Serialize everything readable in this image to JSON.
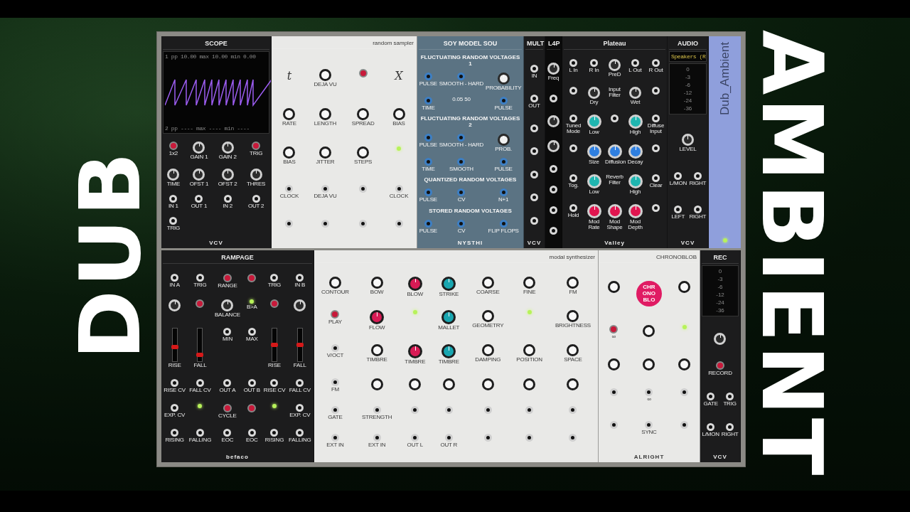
{
  "overlay": {
    "left_title": "DUB",
    "right_title": "AMBIENT"
  },
  "rows": [
    {
      "modules": [
        {
          "kind": "panel",
          "color": "#1c1c1d",
          "title": "SCOPE",
          "footer": "VCV",
          "screen": {
            "top": "1 pp 10.00 max 10.00 min 0.00",
            "bottom": "2 pp ---- max ---- min ----"
          },
          "controls": [
            {
              "kind": "button",
              "label": "1x2"
            },
            {
              "kind": "knob",
              "label": "GAIN 1"
            },
            {
              "kind": "knob",
              "label": "GAIN 2"
            },
            {
              "kind": "button",
              "label": "TRIG"
            },
            {
              "kind": "knob",
              "label": "TIME"
            },
            {
              "kind": "knob",
              "label": "OFST 1"
            },
            {
              "kind": "knob",
              "label": "OFST 2"
            },
            {
              "kind": "knob",
              "label": "THRES"
            },
            {
              "kind": "jack",
              "label": "IN 1"
            },
            {
              "kind": "jack",
              "label": "OUT 1"
            },
            {
              "kind": "jack",
              "label": "IN 2"
            },
            {
              "kind": "jack",
              "label": "OUT 2"
            },
            {
              "kind": "jack",
              "label": "TRIG"
            }
          ]
        },
        {
          "kind": "panel",
          "color": "#e9e9e7",
          "title": "random sampler",
          "controls": [
            {
              "kind": "glyph",
              "label": "t"
            },
            {
              "kind": "knob",
              "label": "DEJA VU"
            },
            {
              "kind": "button"
            },
            {
              "kind": "glyph",
              "label": "X"
            },
            {
              "kind": "knob",
              "label": "RATE"
            },
            {
              "kind": "knob",
              "label": "LENGTH"
            },
            {
              "kind": "knob",
              "label": "SPREAD"
            },
            {
              "kind": "knob",
              "label": "BIAS"
            },
            {
              "kind": "knob",
              "label": "BIAS"
            },
            {
              "kind": "knob",
              "label": "JITTER"
            },
            {
              "kind": "knob",
              "label": "STEPS"
            },
            {
              "kind": "led"
            },
            {
              "kind": "jack",
              "label": "CLOCK"
            },
            {
              "kind": "jack",
              "label": "DEJA VU"
            },
            {
              "kind": "jack"
            },
            {
              "kind": "jack",
              "label": "CLOCK"
            },
            {
              "kind": "jack"
            },
            {
              "kind": "jack"
            },
            {
              "kind": "jack"
            },
            {
              "kind": "jack"
            }
          ]
        },
        {
          "kind": "panel",
          "color": "#5b7383",
          "title": "SOY MODEL SOU",
          "footer": "NYSTHI",
          "controls": [
            {
              "kind": "heading",
              "label": "FLUCTUATING RANDOM VOLTAGES 1"
            },
            {
              "kind": "jack",
              "label": "PULSE"
            },
            {
              "kind": "jack",
              "label": "SMOOTH - HARD"
            },
            {
              "kind": "knob",
              "label": "PROBABILITY"
            },
            {
              "kind": "jack",
              "label": "TIME"
            },
            {
              "kind": "text",
              "label": "0.05 50"
            },
            {
              "kind": "jack",
              "label": "PULSE"
            },
            {
              "kind": "heading",
              "label": "FLUCTUATING RANDOM VOLTAGES 2"
            },
            {
              "kind": "jack",
              "label": "PULSE"
            },
            {
              "kind": "jack",
              "label": "SMOOTH - HARD"
            },
            {
              "kind": "knob",
              "label": "PROB."
            },
            {
              "kind": "jack",
              "label": "TIME"
            },
            {
              "kind": "jack",
              "label": "SMOOTH"
            },
            {
              "kind": "jack",
              "label": "PULSE"
            },
            {
              "kind": "heading",
              "label": "QUANTIZED RANDOM VOLTAGES"
            },
            {
              "kind": "jack",
              "label": "PULSE"
            },
            {
              "kind": "jack",
              "label": "CV"
            },
            {
              "kind": "jack",
              "label": "N+1"
            },
            {
              "kind": "heading",
              "label": "STORED RANDOM VOLTAGES"
            },
            {
              "kind": "jack",
              "label": "PULSE"
            },
            {
              "kind": "jack",
              "label": "CV"
            },
            {
              "kind": "jack",
              "label": "FLIP FLOPS"
            }
          ]
        },
        {
          "kind": "panel",
          "color": "#1c1c1d",
          "title": "MULT",
          "footer": "VCV",
          "controls": [
            {
              "kind": "jack",
              "label": "IN"
            },
            {
              "kind": "jack",
              "label": "OUT"
            },
            {
              "kind": "jack"
            },
            {
              "kind": "jack"
            },
            {
              "kind": "jack"
            },
            {
              "kind": "jack"
            },
            {
              "kind": "jack"
            }
          ]
        },
        {
          "kind": "panel",
          "color": "#0b0b0b",
          "title": "L4P",
          "controls": [
            {
              "kind": "knob",
              "label": "Freq"
            },
            {
              "kind": "jack"
            },
            {
              "kind": "knob"
            },
            {
              "kind": "knob"
            },
            {
              "kind": "jack"
            },
            {
              "kind": "jack"
            },
            {
              "kind": "jack"
            },
            {
              "kind": "jack"
            }
          ]
        },
        {
          "kind": "panel",
          "color": "#1c1c1d",
          "title": "Plateau",
          "footer": "Valley",
          "controls": [
            {
              "kind": "jack",
              "label": "L In"
            },
            {
              "kind": "jack",
              "label": "R In"
            },
            {
              "kind": "knob",
              "label": "PreD"
            },
            {
              "kind": "jack",
              "label": "L Out"
            },
            {
              "kind": "jack",
              "label": "R Out"
            },
            {
              "kind": "jack"
            },
            {
              "kind": "knob",
              "label": "Dry"
            },
            {
              "kind": "text",
              "label": "Input Filter"
            },
            {
              "kind": "knob",
              "label": "Wet"
            },
            {
              "kind": "jack"
            },
            {
              "kind": "jack",
              "label": "Tuned Mode"
            },
            {
              "kind": "knob",
              "label": "Low",
              "color": "#1fb5b0"
            },
            {
              "kind": "jack"
            },
            {
              "kind": "knob",
              "label": "High",
              "color": "#1fb5b0"
            },
            {
              "kind": "jack",
              "label": "Diffuse Input"
            },
            {
              "kind": "jack"
            },
            {
              "kind": "knob",
              "label": "Size",
              "color": "#2f7fe0"
            },
            {
              "kind": "knob",
              "label": "Diffusion",
              "color": "#2f7fe0"
            },
            {
              "kind": "knob",
              "label": "Decay",
              "color": "#2f7fe0"
            },
            {
              "kind": "jack"
            },
            {
              "kind": "jack",
              "label": "Tog."
            },
            {
              "kind": "knob",
              "label": "Low",
              "color": "#1fb5b0"
            },
            {
              "kind": "text",
              "label": "Reverb Filter"
            },
            {
              "kind": "knob",
              "label": "High",
              "color": "#1fb5b0"
            },
            {
              "kind": "jack",
              "label": "Clear"
            },
            {
              "kind": "jack",
              "label": "Hold"
            },
            {
              "kind": "knob",
              "label": "Mod Rate",
              "color": "#e0154f"
            },
            {
              "kind": "knob",
              "label": "Mod Shape",
              "color": "#e0154f"
            },
            {
              "kind": "knob",
              "label": "Mod Depth",
              "color": "#e0154f"
            },
            {
              "kind": "jack"
            }
          ]
        },
        {
          "kind": "panel",
          "color": "#1c1c1d",
          "title": "AUDIO",
          "footer": "VCV",
          "display": "Speakers (R",
          "meter": [
            "0",
            "-3",
            "-6",
            "-12",
            "-24",
            "-36"
          ],
          "controls": [
            {
              "kind": "knob",
              "label": "LEVEL",
              "wide": true
            },
            {
              "kind": "jack",
              "label": "L/MON"
            },
            {
              "kind": "jack",
              "label": "RIGHT"
            },
            {
              "kind": "jack",
              "label": "LEFT"
            },
            {
              "kind": "jack",
              "label": "RIGHT"
            }
          ]
        },
        {
          "kind": "notes",
          "text": "Dub_Ambient"
        }
      ]
    },
    {
      "modules": [
        {
          "kind": "panel",
          "color": "#1c1c1d",
          "title": "RAMPAGE",
          "footer": "befaco",
          "controls": [
            {
              "kind": "jack",
              "label": "IN A"
            },
            {
              "kind": "jack",
              "label": "TRIG"
            },
            {
              "kind": "button",
              "label": "RANGE"
            },
            {
              "kind": "button"
            },
            {
              "kind": "jack",
              "label": "TRIG"
            },
            {
              "kind": "jack",
              "label": "IN B"
            },
            {
              "kind": "knob"
            },
            {
              "kind": "button"
            },
            {
              "kind": "knob",
              "label": "BALANCE"
            },
            {
              "kind": "led",
              "label": "B>A"
            },
            {
              "kind": "button"
            },
            {
              "kind": "knob"
            },
            {
              "kind": "slider",
              "label": "RISE",
              "level": 0.45
            },
            {
              "kind": "slider",
              "label": "FALL",
              "level": 0.2
            },
            {
              "kind": "jack",
              "label": "MIN"
            },
            {
              "kind": "jack",
              "label": "MAX"
            },
            {
              "kind": "slider",
              "label": "RISE",
              "level": 0.5
            },
            {
              "kind": "slider",
              "label": "FALL",
              "level": 0.5
            },
            {
              "kind": "jack",
              "label": "RISE CV"
            },
            {
              "kind": "jack",
              "label": "FALL CV"
            },
            {
              "kind": "jack",
              "label": "OUT A"
            },
            {
              "kind": "jack",
              "label": "OUT B"
            },
            {
              "kind": "jack",
              "label": "RISE CV"
            },
            {
              "kind": "jack",
              "label": "FALL CV"
            },
            {
              "kind": "jack",
              "label": "EXP. CV"
            },
            {
              "kind": "led"
            },
            {
              "kind": "button",
              "label": "CYCLE"
            },
            {
              "kind": "button"
            },
            {
              "kind": "led"
            },
            {
              "kind": "jack",
              "label": "EXP. CV"
            },
            {
              "kind": "jack",
              "label": "RISING"
            },
            {
              "kind": "jack",
              "label": "FALLING"
            },
            {
              "kind": "jack",
              "label": "EOC"
            },
            {
              "kind": "jack",
              "label": "EOC"
            },
            {
              "kind": "jack",
              "label": "RISING"
            },
            {
              "kind": "jack",
              "label": "FALLING"
            }
          ]
        },
        {
          "kind": "panel",
          "color": "#e9e9e7",
          "title": "modal synthesizer",
          "controls": [
            {
              "kind": "knob",
              "label": "CONTOUR"
            },
            {
              "kind": "knob",
              "label": "BOW"
            },
            {
              "kind": "knob",
              "label": "BLOW",
              "color": "#d81b55"
            },
            {
              "kind": "knob",
              "label": "STRIKE",
              "color": "#19a6b0"
            },
            {
              "kind": "knob",
              "label": "COARSE"
            },
            {
              "kind": "knob",
              "label": "FINE"
            },
            {
              "kind": "knob",
              "label": "FM"
            },
            {
              "kind": "button",
              "label": "PLAY"
            },
            {
              "kind": "knob",
              "label": "FLOW",
              "color": "#d81b55"
            },
            {
              "kind": "led"
            },
            {
              "kind": "knob",
              "label": "MALLET",
              "color": "#19a6b0"
            },
            {
              "kind": "knob",
              "label": "GEOMETRY"
            },
            {
              "kind": "led"
            },
            {
              "kind": "knob",
              "label": "BRIGHTNESS"
            },
            {
              "kind": "jack",
              "label": "V/OCT"
            },
            {
              "kind": "knob",
              "label": "TIMBRE"
            },
            {
              "kind": "knob",
              "label": "TIMBRE",
              "color": "#d81b55"
            },
            {
              "kind": "knob",
              "label": "TIMBRE",
              "color": "#19a6b0"
            },
            {
              "kind": "knob",
              "label": "DAMPING"
            },
            {
              "kind": "knob",
              "label": "POSITION"
            },
            {
              "kind": "knob",
              "label": "SPACE"
            },
            {
              "kind": "jack",
              "label": "FM"
            },
            {
              "kind": "knob"
            },
            {
              "kind": "knob"
            },
            {
              "kind": "knob"
            },
            {
              "kind": "knob"
            },
            {
              "kind": "knob"
            },
            {
              "kind": "knob"
            },
            {
              "kind": "jack",
              "label": "GATE"
            },
            {
              "kind": "jack",
              "label": "STRENGTH"
            },
            {
              "kind": "jack"
            },
            {
              "kind": "jack"
            },
            {
              "kind": "jack"
            },
            {
              "kind": "jack"
            },
            {
              "kind": "jack"
            },
            {
              "kind": "jack",
              "label": "EXT IN"
            },
            {
              "kind": "jack",
              "label": "EXT IN"
            },
            {
              "kind": "jack",
              "label": "OUT L"
            },
            {
              "kind": "jack",
              "label": "OUT R"
            },
            {
              "kind": "jack"
            },
            {
              "kind": "jack"
            },
            {
              "kind": "jack"
            }
          ]
        },
        {
          "kind": "panel",
          "color": "#e9e9e7",
          "title": "CHRONOBLOB",
          "footer": "ALRIGHT",
          "controls": [
            {
              "kind": "knob"
            },
            {
              "kind": "logo",
              "label": "CHR ONO BLO"
            },
            {
              "kind": "knob"
            },
            {
              "kind": "button",
              "label": "∞"
            },
            {
              "kind": "knob"
            },
            {
              "kind": "led"
            },
            {
              "kind": "knob"
            },
            {
              "kind": "knob"
            },
            {
              "kind": "knob"
            },
            {
              "kind": "jack"
            },
            {
              "kind": "jack",
              "label": "∞"
            },
            {
              "kind": "jack"
            },
            {
              "kind": "jack"
            },
            {
              "kind": "jack",
              "label": "SYNC"
            },
            {
              "kind": "jack"
            }
          ]
        },
        {
          "kind": "panel",
          "color": "#1c1c1d",
          "title": "REC",
          "footer": "VCV",
          "meter": [
            "0",
            "-3",
            "-6",
            "-12",
            "-24",
            "-36"
          ],
          "controls": [
            {
              "kind": "knob",
              "wide": true
            },
            {
              "kind": "button",
              "label": "RECORD",
              "wide": true
            },
            {
              "kind": "jack",
              "label": "GATE"
            },
            {
              "kind": "jack",
              "label": "TRIG"
            },
            {
              "kind": "jack",
              "label": "L/MON"
            },
            {
              "kind": "jack",
              "label": "RIGHT"
            }
          ]
        }
      ]
    }
  ]
}
